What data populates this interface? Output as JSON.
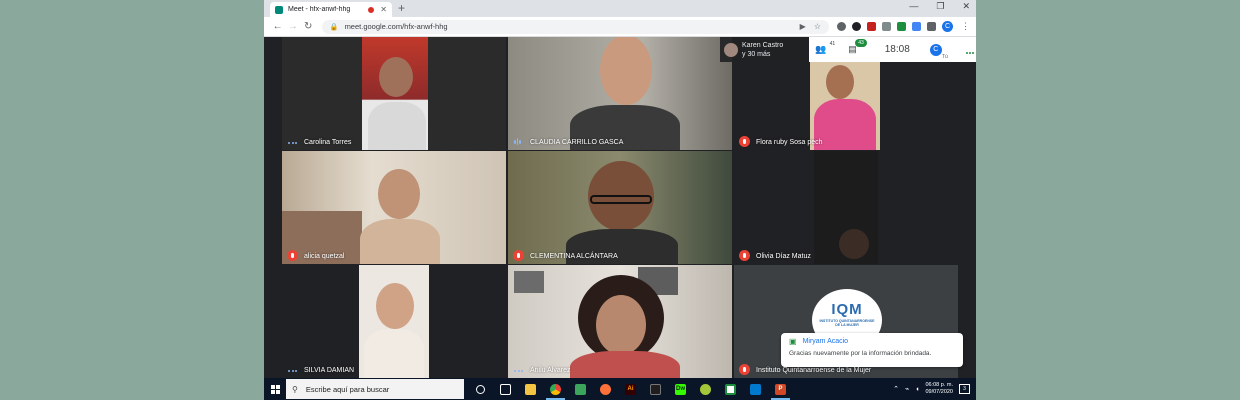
{
  "browser": {
    "tab_title": "Meet - hfx-anwf-hhg",
    "url": "meet.google.com/hfx-anwf-hhg",
    "profile_initial": "C"
  },
  "meet": {
    "presenter_line1": "Karen Castro",
    "presenter_line2": "y 30 más",
    "people_count": "41",
    "chat_badge": "43",
    "time": "18:08",
    "me_initial": "C",
    "me_label": "Tú",
    "participants": [
      {
        "name": "Carolina Torres",
        "status": "talking"
      },
      {
        "name": "CLAUDIA CARRILLO GASCA",
        "status": "speaking"
      },
      {
        "name": "Flora ruby Sosa pech",
        "status": "muted"
      },
      {
        "name": "alicia quetzal",
        "status": "muted"
      },
      {
        "name": "CLEMENTINA ALCÁNTARA",
        "status": "muted"
      },
      {
        "name": "Olivia Díaz Matuz",
        "status": "muted"
      },
      {
        "name": "SILVIA DAMIAN",
        "status": "talking"
      },
      {
        "name": "Anilu Alvarez",
        "status": "talking"
      },
      {
        "name": "Instituto Quintanarroense de la Mujer",
        "status": "muted"
      }
    ],
    "logo_text": "IQM",
    "logo_subtext": "INSTITUTO QUINTANARROENSE DE LA MUJER",
    "notification": {
      "sender": "Miryam Acacio",
      "message": "Gracias  nuevamente por la información brindada."
    }
  },
  "taskbar": {
    "search_placeholder": "Escribe aquí para buscar",
    "time": "06:08 p. m.",
    "date": "09/07/2020",
    "notification_count": "3"
  }
}
